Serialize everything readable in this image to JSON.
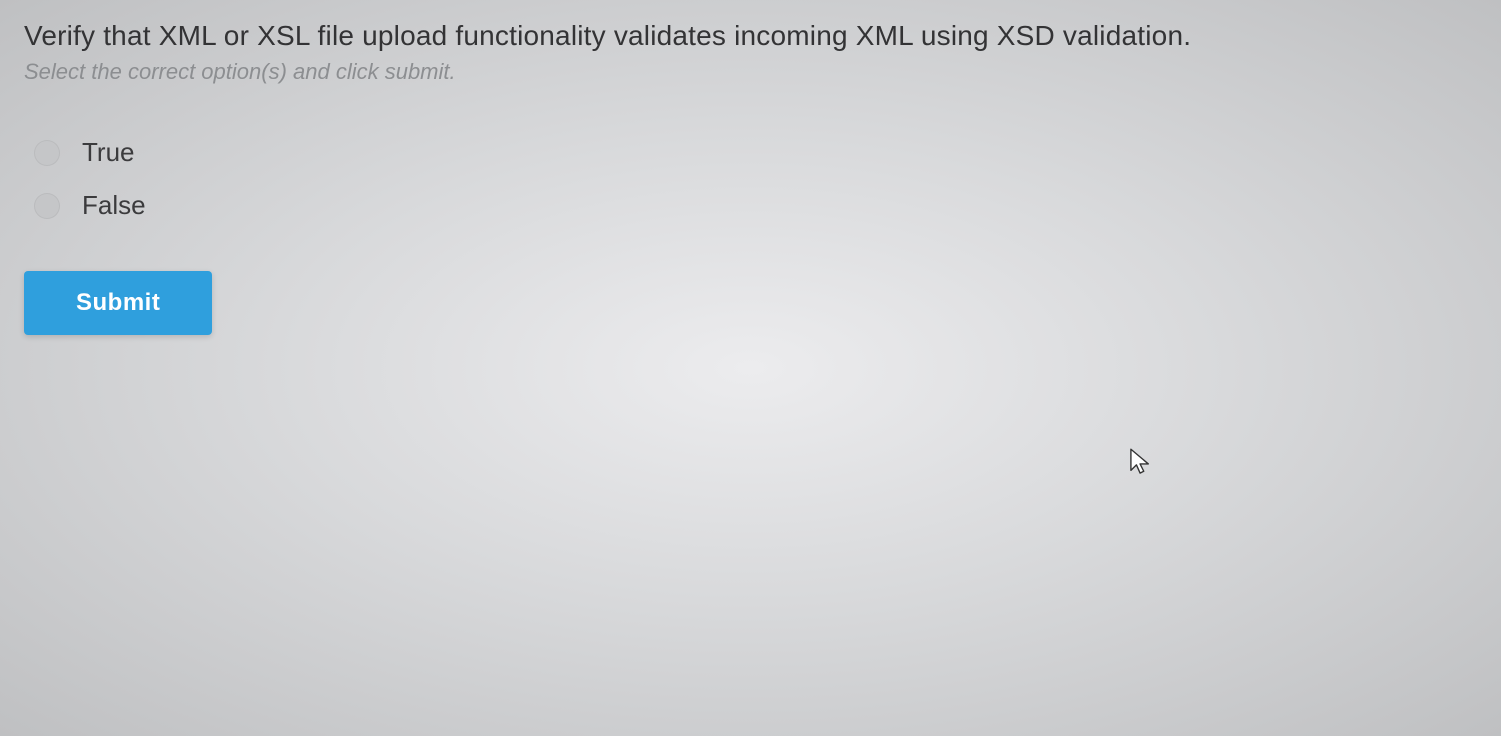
{
  "question": {
    "text": "Verify that XML or XSL file upload functionality validates incoming XML using XSD validation.",
    "instruction": "Select the correct option(s) and click submit.",
    "options": [
      {
        "label": "True",
        "selected": false
      },
      {
        "label": "False",
        "selected": false
      }
    ]
  },
  "buttons": {
    "submit": "Submit"
  }
}
